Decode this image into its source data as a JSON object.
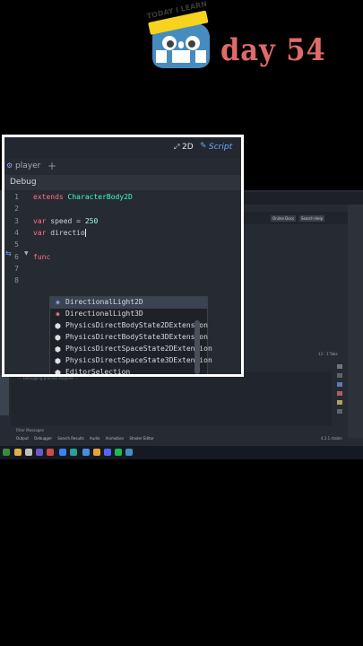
{
  "banner": {
    "logo_badge": "TODAY I LEARN",
    "day_text": "day 54"
  },
  "panel": {
    "view_2d": "2D",
    "view_script": "Script",
    "tab_name": "player",
    "add_tab": "+",
    "debug_label": "Debug",
    "code_lines": [
      {
        "n": "1",
        "parts": [
          [
            "kw",
            "extends"
          ],
          [
            "",
            " "
          ],
          [
            "ty",
            "CharacterBody2D"
          ]
        ]
      },
      {
        "n": "2",
        "parts": []
      },
      {
        "n": "3",
        "parts": [
          [
            "kw",
            "var"
          ],
          [
            "",
            " speed = "
          ],
          [
            "num",
            "250"
          ]
        ]
      },
      {
        "n": "4",
        "parts": [
          [
            "kw",
            "var"
          ],
          [
            "",
            " directio"
          ]
        ]
      },
      {
        "n": "5",
        "parts": []
      },
      {
        "n": "6",
        "parts": [
          [
            "kw",
            "func"
          ]
        ]
      },
      {
        "n": "7",
        "parts": []
      },
      {
        "n": "8",
        "parts": []
      }
    ],
    "autocomplete": [
      {
        "label": "DirectionalLight2D",
        "icon": "light-2d-icon",
        "color": "#8da5f3",
        "selected": true
      },
      {
        "label": "DirectionalLight3D",
        "icon": "light-3d-icon",
        "color": "#fc7f7f",
        "selected": false
      },
      {
        "label": "PhysicsDirectBodyState2DExtension",
        "icon": "object-icon",
        "color": "#e0e0e0",
        "selected": false
      },
      {
        "label": "PhysicsDirectBodyState3DExtension",
        "icon": "object-icon",
        "color": "#e0e0e0",
        "selected": false
      },
      {
        "label": "PhysicsDirectSpaceState2DExtension",
        "icon": "object-icon",
        "color": "#e0e0e0",
        "selected": false
      },
      {
        "label": "PhysicsDirectSpaceState3DExtension",
        "icon": "object-icon",
        "color": "#e0e0e0",
        "selected": false
      },
      {
        "label": "EditorSelection",
        "icon": "object-icon",
        "color": "#e0e0e0",
        "selected": false
      }
    ]
  },
  "background_editor": {
    "online_docs": "Online Docs",
    "search_help": "Search Help",
    "filter_messages": "Filter Messages",
    "console_line": "--- Debugging process stopped ---",
    "bottom_tabs": [
      "Output",
      "Debugger",
      "Search Results",
      "Audio",
      "Animation",
      "Shader Editor"
    ],
    "version": "4.2.1.stable",
    "page_info": "13 : 1  Tabs"
  },
  "colors": {
    "accent": "#68a9ff",
    "keyword": "#ff7085",
    "type": "#42ffc2",
    "day_text": "#e06a6a"
  }
}
